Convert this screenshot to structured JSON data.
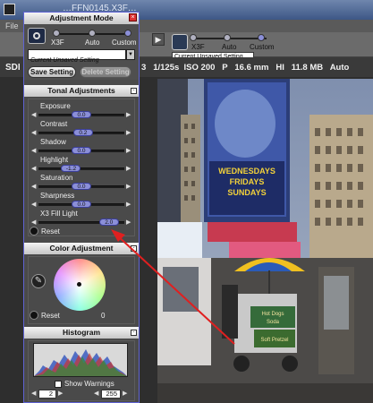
{
  "app": {
    "title": "…FFN0145.X3F…",
    "menu_file": "File",
    "info_left": "SDI",
    "info_text": "3   1/125s  ISO 200   P   16.6 mm   HI   11.8 MB   Auto",
    "toolbar_right": {
      "mode_labels": [
        "X3F",
        "Auto",
        "Custom"
      ],
      "setting_value": "Current Unsaved Setting"
    }
  },
  "panel": {
    "title": "Adjustment Mode",
    "mode": {
      "labels": [
        "X3F",
        "Auto",
        "Custom"
      ],
      "selected": "Custom",
      "setting_value": "Current Unsaved Setting"
    },
    "save_label": "Save Setting",
    "delete_label": "Delete Setting",
    "tonal": {
      "title": "Tonal Adjustments",
      "sliders": [
        {
          "label": "Exposure",
          "value": "0.0",
          "pos": 0.5
        },
        {
          "label": "Contrast",
          "value": "0.2",
          "pos": 0.52
        },
        {
          "label": "Shadow",
          "value": "0.0",
          "pos": 0.5
        },
        {
          "label": "Highlight",
          "value": "-1.2",
          "pos": 0.38
        },
        {
          "label": "Saturation",
          "value": "0.0",
          "pos": 0.5
        },
        {
          "label": "Sharpness",
          "value": "0.0",
          "pos": 0.5
        },
        {
          "label": "X3 Fill Light",
          "value": "2.0",
          "pos": 0.82
        }
      ],
      "reset_label": "Reset"
    },
    "color": {
      "title": "Color Adjustment",
      "reset_label": "Reset",
      "value": "0"
    },
    "histogram": {
      "title": "Histogram",
      "show_warnings_label": "Show Warnings",
      "low_value": "2",
      "high_value": "255"
    }
  },
  "photo_signs": {
    "billboard_1": "WEDNESDAYS",
    "billboard_2": "FRIDAYS",
    "billboard_3": "SUNDAYS",
    "cart_1": "Hot Dogs",
    "cart_2": "Soda",
    "cart_3": "Soft Pretzel"
  },
  "colors": {
    "panel_border": "#5f63d4",
    "value_pill": "#8b8fd8",
    "arrow": "#e02020"
  }
}
